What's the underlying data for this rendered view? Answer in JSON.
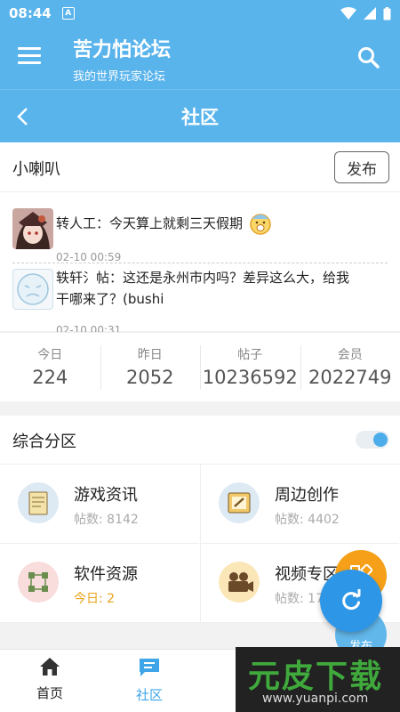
{
  "status_bar": {
    "time": "08:44",
    "notif_letter": "A"
  },
  "app_bar": {
    "title": "苦力怕论坛",
    "subtitle": "我的世界玩家论坛"
  },
  "sub_bar": {
    "title": "社区"
  },
  "shoutbox": {
    "label": "小喇叭",
    "post_label": "发布",
    "items": [
      {
        "text": "转人工：今天算上就剩三天假期",
        "time": "02-10 00:59"
      },
      {
        "text": "轶轩氵帖：这还是永州市内吗？差异这么大，给我干哪来了？(bushi",
        "time": "02-10 00:31"
      }
    ]
  },
  "stats": [
    {
      "label": "今日",
      "value": "224"
    },
    {
      "label": "昨日",
      "value": "2052"
    },
    {
      "label": "帖子",
      "value": "10236592"
    },
    {
      "label": "会员",
      "value": "2022749"
    }
  ],
  "section": {
    "label": "综合分区",
    "toggle_on": true
  },
  "forums": [
    {
      "name": "游戏资讯",
      "count": "帖数: 8142"
    },
    {
      "name": "周边创作",
      "count": "帖数: 4402"
    },
    {
      "name": "软件资源",
      "count": "今日: 2"
    },
    {
      "name": "视频专区",
      "count": "帖数: 17"
    }
  ],
  "bottom_nav": [
    {
      "label": "首页"
    },
    {
      "label": "社区"
    }
  ],
  "fab_label": "发布",
  "watermark": {
    "text": "元皮下载",
    "url": "www.yuanpi.com"
  },
  "colors": {
    "primary": "#5ab4ec",
    "accent": "#3ea6e8",
    "today": "#e8a317",
    "fab_orange": "#f5a018"
  }
}
